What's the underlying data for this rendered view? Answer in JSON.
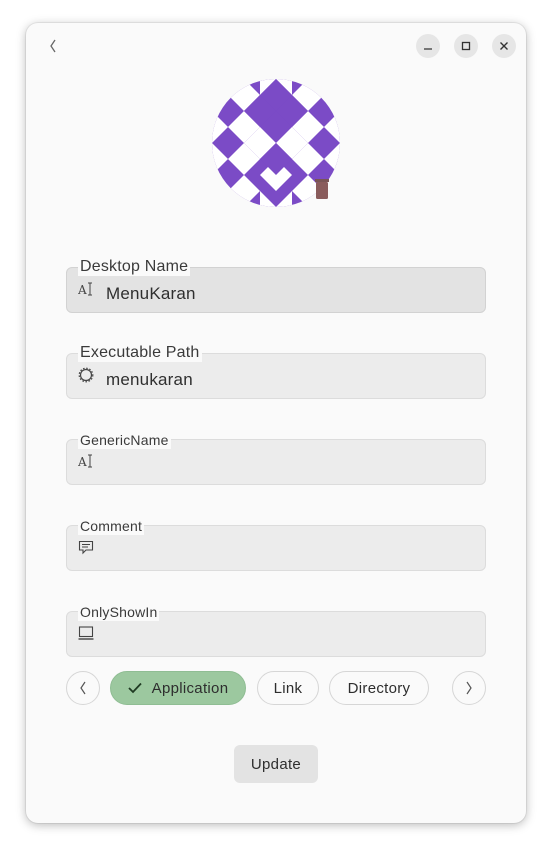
{
  "window": {
    "controls": {
      "back_icon": "chevron-left-icon",
      "minimize_icon": "minimize-icon",
      "maximize_icon": "maximize-icon",
      "close_icon": "close-icon"
    },
    "avatar": {
      "icon": "identicon-avatar",
      "colors": {
        "primary": "#7b4bc6",
        "background": "#ffffff"
      },
      "delete_icon": "trash-icon",
      "delete_color": "#8a5c5c"
    }
  },
  "form": {
    "fields": [
      {
        "label": "Desktop Name",
        "icon": "text-icon",
        "value": "MenuKaran"
      },
      {
        "label": "Executable Path",
        "icon": "gear-icon",
        "value": "menukaran"
      },
      {
        "label": "GenericName",
        "icon": "text-icon",
        "value": ""
      },
      {
        "label": "Comment",
        "icon": "comment-icon",
        "value": ""
      },
      {
        "label": "OnlyShowIn",
        "icon": "monitor-icon",
        "value": ""
      }
    ]
  },
  "type_selector": {
    "prev_icon": "chevron-left-icon",
    "next_icon": "chevron-right-icon",
    "options": [
      {
        "label": "Application",
        "selected": true
      },
      {
        "label": "Link",
        "selected": false
      },
      {
        "label": "Directory",
        "selected": false
      }
    ],
    "selected_color": "#9cc89f"
  },
  "actions": {
    "update_label": "Update"
  }
}
